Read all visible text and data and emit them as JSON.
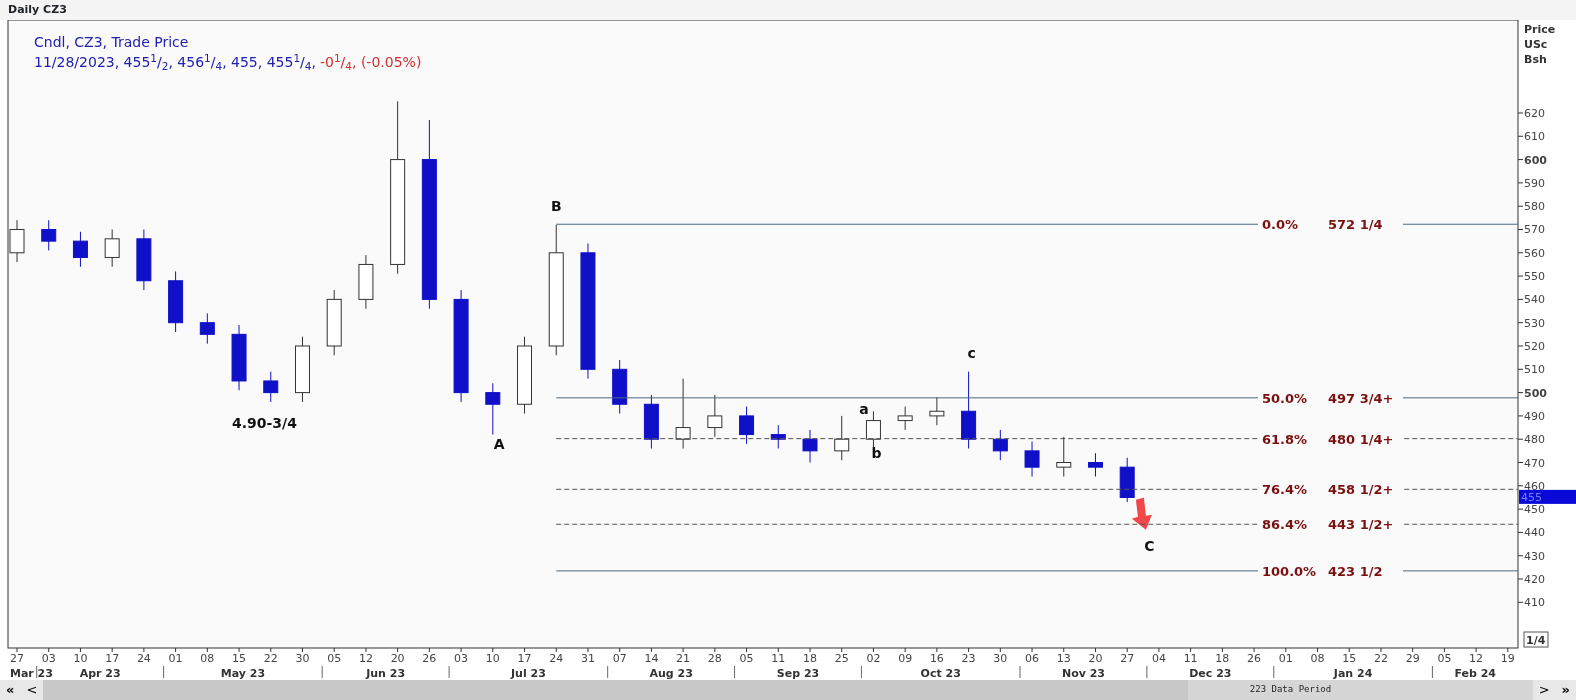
{
  "window": {
    "title": "Daily CZ3"
  },
  "legend": {
    "line_1": "Cndl, CZ3, Trade Price",
    "line_2": "11/28/2023, 455$^{1}$/$_{2}$, 456$^{1}$/$_{4}$, 455, 455$^{1}$/$_{4}$,",
    "change": "-0$^{1}$/$_{4}$, (-0.05%)"
  },
  "chart": {
    "axis_title": [
      "Price",
      "USc",
      "Bsh"
    ],
    "price_tag": "455",
    "scale_button": "1/4",
    "retracements": [
      {
        "percent": "0.0%",
        "price": "572 1/4"
      },
      {
        "percent": "50.0%",
        "price": "497 3/4+"
      },
      {
        "percent": "61.8%",
        "price": "480 1/4+"
      },
      {
        "percent": "76.4%",
        "price": "458 1/2+"
      },
      {
        "percent": "86.4%",
        "price": "443 1/2+"
      },
      {
        "percent": "100.0%",
        "price": "423 1/2"
      }
    ],
    "months": [
      "Mar 23",
      "Apr 23",
      "May 23",
      "Jun 23",
      "Jul 23",
      "Aug 23",
      "Sep 23",
      "Oct 23",
      "Nov 23",
      "Dec 23",
      "Jan 24",
      "Feb 24"
    ],
    "chart_data": {
      "type": "candlestick",
      "categories": [
        "27",
        "03",
        "10",
        "17",
        "24",
        "01",
        "08",
        "15",
        "22",
        "30",
        "05",
        "12",
        "20",
        "26",
        "03",
        "10",
        "17",
        "24",
        "31",
        "07",
        "14",
        "21",
        "28",
        "05",
        "11",
        "18",
        "25",
        "02",
        "09",
        "16",
        "23",
        "30",
        "06",
        "13",
        "20",
        "27",
        "04",
        "11",
        "18",
        "26",
        "01",
        "08",
        "15",
        "22",
        "29",
        "05",
        "12",
        "19"
      ],
      "ohlc": [
        [
          560,
          574,
          556,
          570
        ],
        [
          570,
          574,
          561,
          565
        ],
        [
          565,
          569,
          554,
          558
        ],
        [
          558,
          570,
          554,
          566
        ],
        [
          566,
          570,
          544,
          548
        ],
        [
          548,
          552,
          526,
          530
        ],
        [
          530,
          534,
          521,
          525
        ],
        [
          525,
          529,
          501,
          505
        ],
        [
          505,
          509,
          496,
          500
        ],
        [
          500,
          524,
          496,
          520
        ],
        [
          520,
          544,
          516,
          540
        ],
        [
          540,
          559,
          536,
          555
        ],
        [
          555,
          625,
          551,
          600
        ],
        [
          600,
          617,
          536,
          540
        ],
        [
          540,
          544,
          496,
          500
        ],
        [
          500,
          504,
          482,
          495
        ],
        [
          495,
          524,
          491,
          520
        ],
        [
          520,
          572,
          516,
          560
        ],
        [
          560,
          564,
          506,
          510
        ],
        [
          510,
          514,
          491,
          495
        ],
        [
          495,
          499,
          476,
          480
        ],
        [
          480,
          506,
          476,
          485
        ],
        [
          485,
          499,
          481,
          490
        ],
        [
          490,
          494,
          478,
          482
        ],
        [
          482,
          486,
          476,
          480
        ],
        [
          480,
          484,
          470,
          475
        ],
        [
          475,
          490,
          471,
          480
        ],
        [
          480,
          492,
          476,
          488
        ],
        [
          488,
          494,
          484,
          490
        ],
        [
          490,
          498,
          486,
          492
        ],
        [
          492,
          509,
          476,
          480
        ],
        [
          480,
          484,
          471,
          475
        ],
        [
          475,
          479,
          464,
          468
        ],
        [
          468,
          481,
          464,
          470
        ],
        [
          470,
          474,
          464,
          468
        ],
        [
          468,
          472,
          453,
          455
        ],
        null,
        null,
        null,
        null,
        null,
        null,
        null,
        null,
        null,
        null,
        null,
        null
      ],
      "ylim": [
        390.4,
        659.9
      ],
      "yticks": [
        410,
        420,
        430,
        440,
        450,
        460,
        470,
        480,
        490,
        500,
        510,
        520,
        530,
        540,
        550,
        560,
        570,
        580,
        590,
        600,
        610,
        620
      ],
      "annotations": [
        {
          "text": "B"
        },
        {
          "text": "A"
        },
        {
          "text": "a"
        },
        {
          "text": "b"
        },
        {
          "text": "c"
        },
        {
          "text": "C"
        },
        {
          "text": "4.90-3/4"
        }
      ]
    }
  },
  "scrollbar": {
    "first": "«",
    "prev": "<",
    "period": "223 Data Period",
    "next": ">",
    "last": "»"
  }
}
